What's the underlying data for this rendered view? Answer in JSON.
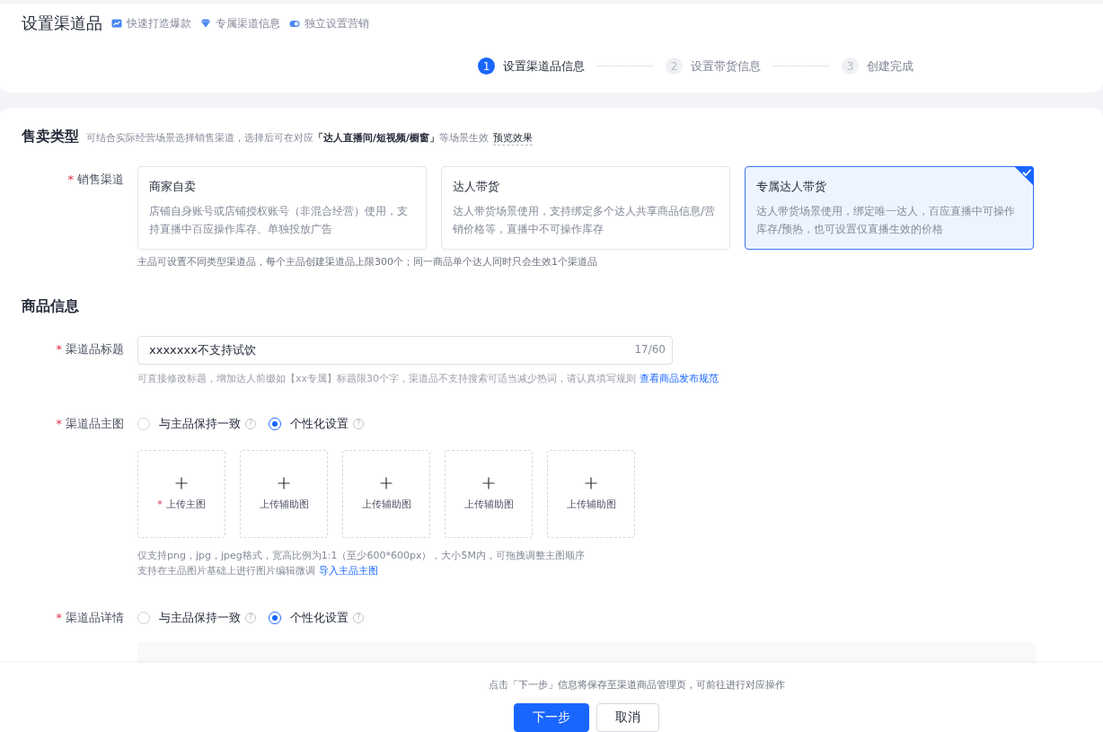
{
  "header": {
    "title": "设置渠道品",
    "features": [
      {
        "kind": "chart",
        "label": "快速打造爆款"
      },
      {
        "kind": "gem",
        "label": "专属渠道信息"
      },
      {
        "kind": "toggle",
        "label": "独立设置营销"
      }
    ]
  },
  "steps": [
    {
      "number": "1",
      "label": "设置渠道品信息",
      "selected": true
    },
    {
      "number": "2",
      "label": "设置带货信息",
      "selected": false
    },
    {
      "number": "3",
      "label": "创建完成",
      "selected": false
    }
  ],
  "sale_type": {
    "title": "售卖类型",
    "hint_before": "可结合实际经营场景选择销售渠道，选择后可在对应",
    "hint_bold": "「达人直播间/短视频/橱窗」",
    "hint_after": "等场景生效",
    "preview_link": "预览效果",
    "channel_label": "销售渠道",
    "required_mark": "*",
    "channels": [
      {
        "title": "商家自卖",
        "desc": "店铺自身账号或店铺授权账号（非混合经营）使用，支持直播中百应操作库存、单独投放广告",
        "selected": false
      },
      {
        "title": "达人带货",
        "desc": "达人带货场景使用，支持绑定多个达人共享商品信息/营销价格等，直播中不可操作库存",
        "selected": false
      },
      {
        "title": "专属达人带货",
        "desc": "达人带货场景使用，绑定唯一达人，百应直播中可操作库存/预热，也可设置仅直播生效的价格",
        "selected": true
      }
    ],
    "note": "主品可设置不同类型渠道品，每个主品创建渠道品上限300个；同一商品单个达人同时只会生效1个渠道品"
  },
  "product_info": {
    "title": "商品信息",
    "title_field": {
      "label": "渠道品标题",
      "required_mark": "*",
      "value": "xxxxxxx不支持试饮",
      "counter": "17/60",
      "hint": "可直接修改标题，增加达人前缀如【xx专属】标题限30个字，渠道品不支持搜索可适当减少热词，请认真填写规则",
      "link": "查看商品发布规范"
    },
    "main_image": {
      "label": "渠道品主图",
      "required_mark": "*",
      "options": [
        {
          "label": "与主品保持一致",
          "selected": false,
          "help": "?"
        },
        {
          "label": "个性化设置",
          "selected": true,
          "help": "?"
        }
      ],
      "uploads": [
        {
          "label": "上传主图",
          "required_mark": "*"
        },
        {
          "label": "上传辅助图"
        },
        {
          "label": "上传辅助图"
        },
        {
          "label": "上传辅助图"
        },
        {
          "label": "上传辅助图"
        }
      ],
      "hint_1": "仅支持png，jpg，jpeg格式，宽高比例为1:1（至少600*600px），大小5M内，可拖拽调整主图顺序",
      "hint_2": "支持在主品图片基础上进行图片编辑微调",
      "link": "导入主品主图"
    },
    "detail": {
      "label": "渠道品详情",
      "required_mark": "*",
      "options": [
        {
          "label": "与主品保持一致",
          "selected": false,
          "help": "?"
        },
        {
          "label": "个性化设置",
          "selected": true,
          "help": "?"
        }
      ]
    }
  },
  "footer": {
    "note": "点击「下一步」信息将保存至渠道商品管理页，可前往进行对应操作",
    "buttons": [
      {
        "kind": "primary",
        "label": "下一步"
      },
      {
        "kind": "default",
        "label": "取消"
      }
    ]
  }
}
